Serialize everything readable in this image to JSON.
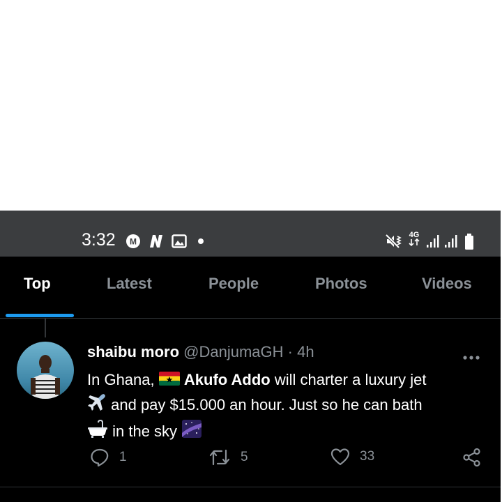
{
  "status_bar": {
    "time": "3:32",
    "left_icons": [
      "messenger-icon",
      "n-app-icon",
      "gallery-icon",
      "notification-dot-icon"
    ],
    "network": "4G",
    "right_icons": [
      "mute-vibrate-icon",
      "4g-data-icon",
      "signal-icon",
      "signal-icon",
      "battery-icon"
    ]
  },
  "tabs": [
    {
      "label": "Top",
      "active": true
    },
    {
      "label": "Latest",
      "active": false
    },
    {
      "label": "People",
      "active": false
    },
    {
      "label": "Photos",
      "active": false
    },
    {
      "label": "Videos",
      "active": false
    }
  ],
  "tweet": {
    "author_name": "shaibu moro",
    "author_handle": "@DanjumaGH",
    "separator": "·",
    "time_ago": "4h",
    "text": {
      "line1_prefix": "In Ghana,",
      "bold": "Akufo Addo",
      "line1_suffix": "will charter a luxury jet",
      "line2": "and pay $15.000 an hour. Just so he can bath",
      "line3": "in the sky"
    },
    "emojis": [
      "ghana-flag-emoji",
      "airplane-emoji",
      "bathtub-emoji",
      "milky-way-emoji"
    ],
    "replies": "1",
    "retweets": "5",
    "likes": "33"
  },
  "colors": {
    "accent": "#1d9bf0",
    "background": "#000000",
    "status_bar": "#3b3d3f",
    "muted_text": "#8b9197",
    "divider": "#2f3336"
  }
}
